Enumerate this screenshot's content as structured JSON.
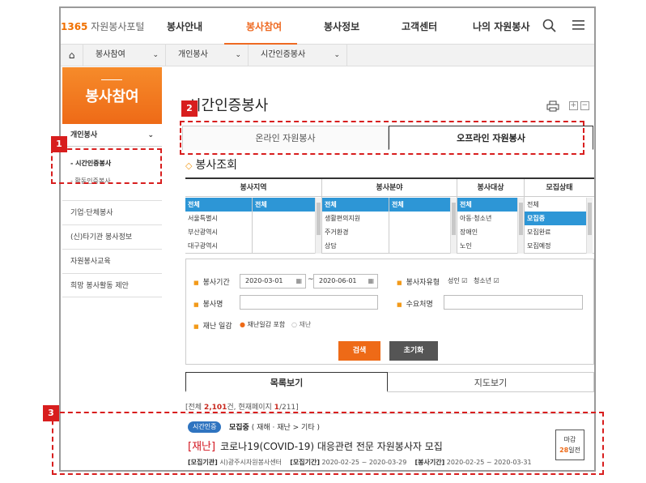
{
  "header": {
    "logo_num": "1365",
    "logo_text": "자원봉사포털",
    "nav": [
      "봉사안내",
      "봉사참여",
      "봉사정보",
      "고객센터",
      "나의 자원봉사"
    ],
    "active_nav": "봉사참여"
  },
  "breadcrumb": [
    "봉사참여",
    "개인봉사",
    "시간인증봉사"
  ],
  "sidebar": {
    "title": "봉사참여",
    "group": "개인봉사",
    "subs": [
      "- 시간인증봉사",
      "- 활동인증봉사"
    ],
    "items": [
      "기업·단체봉사",
      "(신)타기관 봉사정보",
      "자원봉사교육",
      "희망 봉사활동 제안"
    ]
  },
  "page": {
    "title": "시간인증봉사",
    "tabs": [
      "온라인 자원봉사",
      "오프라인 자원봉사"
    ]
  },
  "search": {
    "title": "봉사조회",
    "region": {
      "header": "봉사지역",
      "list": [
        "전체",
        "서울특별시",
        "부산광역시",
        "대구광역시"
      ],
      "sub": [
        "전체"
      ]
    },
    "field": {
      "header": "봉사분야",
      "list": [
        "전체",
        "생활편의지원",
        "주거환경",
        "상담"
      ],
      "sub": [
        "전체"
      ]
    },
    "target": {
      "header": "봉사대상",
      "list": [
        "전체",
        "아동·청소년",
        "장애인",
        "노인"
      ]
    },
    "status": {
      "header": "모집상태",
      "list": [
        "전체",
        "모집중",
        "모집완료",
        "모집예정"
      ]
    },
    "period_label": "봉사기간",
    "date_from": "2020-03-01",
    "date_sep": "~",
    "date_to": "2020-06-01",
    "type_label": "봉사자유형",
    "type_adult": "성인",
    "type_youth": "청소년",
    "name_label": "봉사명",
    "org_label": "수요처명",
    "disaster_label": "재난 일감",
    "disaster_opt1": "재난일감 포함",
    "disaster_opt2": "재난",
    "btn_search": "검색",
    "btn_reset": "초기화"
  },
  "view_tabs": [
    "목록보기",
    "지도보기"
  ],
  "result": {
    "prefix": "[전체 ",
    "total": "2,101",
    "mid": "건, 현재페이지 ",
    "page": "1",
    "suffix": "/211]"
  },
  "card": {
    "badge": "시간인증",
    "status": "모집중",
    "category": "( 재해 · 재난 > 기타 )",
    "tag": "[재난]",
    "title": "코로나19(COVID-19) 대응관련 전문 자원봉사자 모집",
    "org_label": "[모집기관]",
    "org": "시)광주시자원봉사센터",
    "recruit_label": "[모집기간]",
    "recruit": "2020-02-25 ~ 2020-03-29",
    "service_label": "[봉사기간]",
    "service": "2020-02-25 ~ 2020-03-31",
    "deadline_label": "마감",
    "deadline_days": "28",
    "deadline_suffix": "일전"
  },
  "annotations": [
    "1",
    "2",
    "3"
  ],
  "colors": {
    "accent": "#ee6a17",
    "select_blue": "#2d96d6",
    "annotation_red": "#d81e1e"
  }
}
